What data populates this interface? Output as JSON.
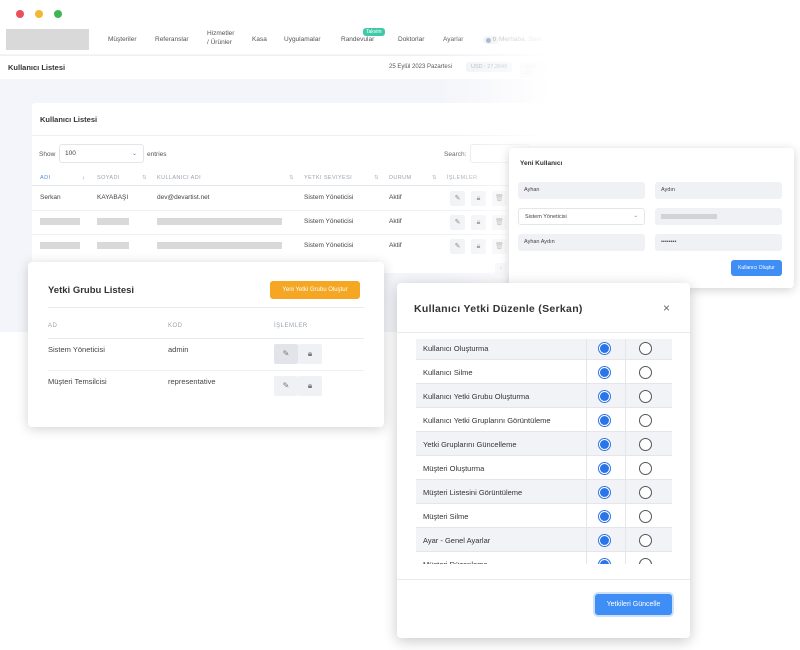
{
  "nav": {
    "items": [
      "Müşteriler",
      "Referanslar",
      "Hizmetler",
      "/ Ürünler",
      "Kasa",
      "Uygulamalar",
      "Randevular",
      "Doktorlar",
      "Ayarlar"
    ],
    "badge": "Takvim",
    "notifications": "0",
    "greeting": "Merhaba, Serk"
  },
  "subbar": {
    "title": "Kullanıcı Listesi",
    "date": "25 Eylül 2023 Pazartesi",
    "usd": "USD : 27.2649",
    "eur": "EUR : 28"
  },
  "user_list": {
    "title": "Kullanıcı Listesi",
    "show_label": "Show",
    "show_value": "100",
    "entries_label": "entries",
    "search_label": "Search:",
    "columns": [
      "ADI",
      "SOYADI",
      "KULLANICI ADI",
      "YETKI SEVIYESI",
      "DURUM",
      "İŞLEMLER"
    ],
    "rows": [
      {
        "name": "Serkan",
        "surname": "KAYABAŞI",
        "username": "dev@devartist.net",
        "level": "Sistem Yöneticisi",
        "status": "Aktif"
      },
      {
        "name": "",
        "surname": "",
        "username": "",
        "level": "Sistem Yöneticisi",
        "status": "Aktif"
      },
      {
        "name": "",
        "surname": "",
        "username": "",
        "level": "Sistem Yöneticisi",
        "status": "Aktif"
      }
    ]
  },
  "new_user": {
    "title": "Yeni Kullanıcı",
    "first_name": "Ayhan",
    "last_name": "Aydın",
    "role": "Sistem Yöneticisi",
    "display_name": "Ayhan Aydın",
    "password": "••••••••",
    "button": "Kullanıcı Oluştur"
  },
  "group_list": {
    "title": "Yetki Grubu Listesi",
    "button": "Yeni Yetki Grubu Oluştur",
    "columns": [
      "AD",
      "KOD",
      "İŞLEMLER"
    ],
    "rows": [
      {
        "name": "Sistem Yöneticisi",
        "code": "admin"
      },
      {
        "name": "Müşteri Temsilcisi",
        "code": "representative"
      }
    ]
  },
  "modal": {
    "title": "Kullanıcı Yetki Düzenle (Serkan)",
    "close": "×",
    "permissions": [
      "Kullanıcı Oluşturma",
      "Kullanıcı Silme",
      "Kullanıcı Yetki Grubu Oluşturma",
      "Kullanıcı Yetki Gruplarını Görüntüleme",
      "Yetki Gruplarını Güncelleme",
      "Müşteri Oluşturma",
      "Müşteri Listesini Görüntüleme",
      "Müşteri Silme",
      "Ayar - Genel Ayarlar",
      "Müşteri Düzenleme"
    ],
    "button": "Yetkileri Güncelle"
  }
}
